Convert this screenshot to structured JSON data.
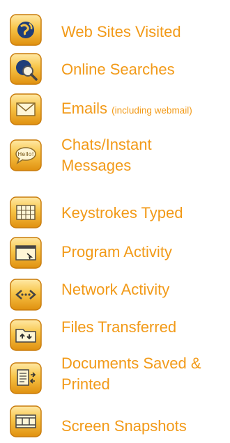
{
  "accent_color": "#f29a18",
  "items": [
    {
      "label": "Web Sites Visited",
      "icon": "globe-icon"
    },
    {
      "label": "Online Searches",
      "icon": "globe-magnifier-icon"
    },
    {
      "label": "Emails",
      "note": "(including webmail)",
      "icon": "envelope-icon"
    },
    {
      "label_line1": "Chats/Instant",
      "label_line2": "Messages",
      "icon": "hello-speech-bubble-icon"
    },
    {
      "label": "Keystrokes Typed",
      "icon": "keyboard-icon"
    },
    {
      "label": "Program Activity",
      "icon": "program-window-icon"
    },
    {
      "label": "Network Activity",
      "icon": "network-arrows-icon"
    },
    {
      "label": "Files Transferred",
      "icon": "folder-transfer-icon"
    },
    {
      "label_line1": "Documents Saved &",
      "label_line2": "Printed",
      "icon": "document-printer-icon"
    },
    {
      "label": "Screen Snapshots",
      "icon": "film-strip-icon"
    }
  ]
}
